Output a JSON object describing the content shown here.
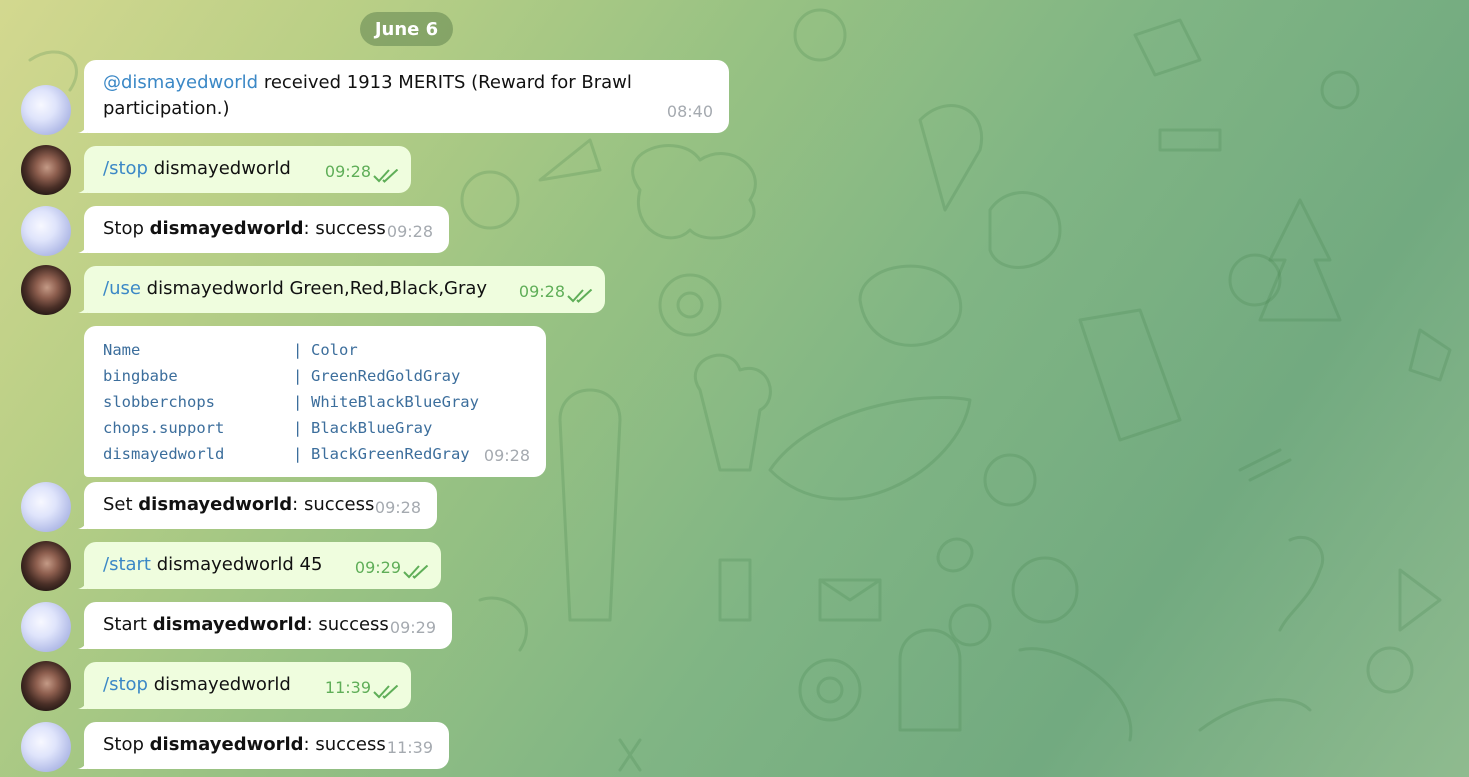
{
  "date_separator": "June 6",
  "messages": [
    {
      "id": "m1",
      "mention": "@dismayedworld",
      "text": "received 1913 MERITS (Reward for Brawl",
      "text2": "participation.)",
      "time": "08:40"
    },
    {
      "id": "m2",
      "command": "/stop",
      "arg": "dismayedworld",
      "time": "09:28"
    },
    {
      "id": "m3",
      "prefix": "Stop",
      "name": "dismayedworld",
      "suffix": ": success",
      "time": "09:28"
    },
    {
      "id": "m4",
      "command": "/use",
      "arg": "dismayedworld Green,Red,Black,Gray",
      "time": "09:28"
    },
    {
      "id": "m5",
      "table": {
        "headers": [
          "Name",
          "Color"
        ],
        "rows": [
          [
            "bingbabe",
            "GreenRedGoldGray"
          ],
          [
            "slobberchops",
            "WhiteBlackBlueGray"
          ],
          [
            "chops.support",
            "BlackBlueGray"
          ],
          [
            "dismayedworld",
            "BlackGreenRedGray"
          ]
        ],
        "separator": "|"
      },
      "time": "09:28"
    },
    {
      "id": "m6",
      "prefix": "Set",
      "name": "dismayedworld",
      "suffix": ": success",
      "time": "09:28"
    },
    {
      "id": "m7",
      "command": "/start",
      "arg": "dismayedworld 45",
      "time": "09:29"
    },
    {
      "id": "m8",
      "prefix": "Start",
      "name": "dismayedworld",
      "suffix": ": success",
      "time": "09:29"
    },
    {
      "id": "m9",
      "command": "/stop",
      "arg": "dismayedworld",
      "time": "11:39"
    },
    {
      "id": "m10",
      "prefix": "Stop",
      "name": "dismayedworld",
      "suffix": ": success",
      "time": "11:39"
    }
  ],
  "colors": {
    "incoming_bubble": "#ffffff",
    "outgoing_bubble": "#effdde",
    "link": "#3b88c6",
    "read_check": "#5fae58"
  }
}
